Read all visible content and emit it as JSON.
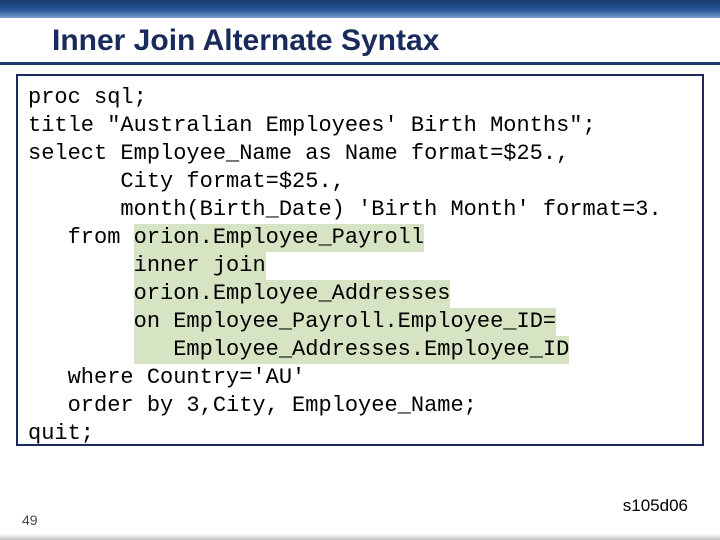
{
  "title": "Inner Join Alternate Syntax",
  "code": {
    "l1": "proc sql;",
    "l2": "title \"Australian Employees' Birth Months\";",
    "l3": "select Employee_Name as Name format=$25.,",
    "l4": "       City format=$25.,",
    "l5": "       month(Birth_Date) 'Birth Month' format=3.",
    "l6a": "   from ",
    "l6b": "orion.Employee_Payroll",
    "l7": "inner join",
    "l8": "orion.Employee_Addresses",
    "l9": "on Employee_Payroll.Employee_ID=",
    "l10": "   Employee_Addresses.Employee_ID",
    "l11": "   where Country='AU'",
    "l12": "   order by 3,City, Employee_Name;",
    "l13": "quit;"
  },
  "page_num": "49",
  "footer_code": "s105d06"
}
